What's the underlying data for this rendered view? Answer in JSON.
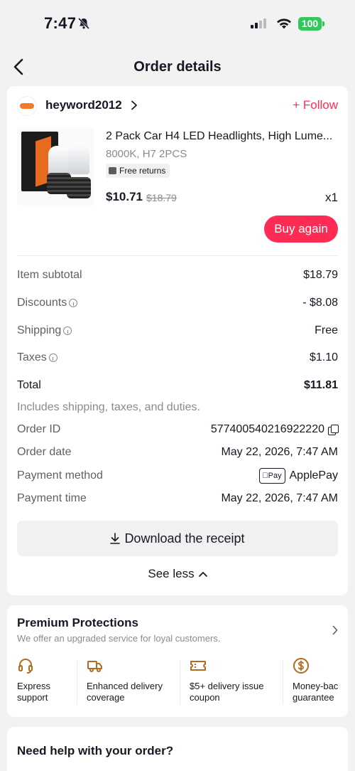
{
  "status_bar": {
    "time": "7:47",
    "battery": "100"
  },
  "nav": {
    "title": "Order details"
  },
  "seller": {
    "name": "heyword2012",
    "follow_label": "+ Follow"
  },
  "product": {
    "title": "2 Pack Car H4 LED Headlights, High Lume...",
    "variant": "8000K, H7 2PCS",
    "badge": "Free returns",
    "price": "$10.71",
    "original_price": "$18.79",
    "quantity": "x1",
    "buy_again_label": "Buy again"
  },
  "summary": {
    "item_subtotal": {
      "label": "Item subtotal",
      "value": "$18.79"
    },
    "discounts": {
      "label": "Discounts",
      "value": "- $8.08"
    },
    "shipping": {
      "label": "Shipping",
      "value": "Free"
    },
    "taxes": {
      "label": "Taxes",
      "value": "$1.10"
    },
    "total": {
      "label": "Total",
      "value": "$11.81"
    },
    "includes_note": "Includes shipping, taxes, and duties."
  },
  "order_info": {
    "order_id": {
      "label": "Order ID",
      "value": "577400540216922220"
    },
    "order_date": {
      "label": "Order date",
      "value": "May 22, 2026, 7:47 AM"
    },
    "payment_method": {
      "label": "Payment method",
      "badge": "Pay",
      "value": "ApplePay"
    },
    "payment_time": {
      "label": "Payment time",
      "value": "May 22, 2026, 7:47 AM"
    }
  },
  "actions": {
    "download_receipt": "Download the receipt",
    "see_less": "See less"
  },
  "premium": {
    "title": "Premium Protections",
    "subtitle": "We offer an upgraded service for loyal customers.",
    "features": [
      {
        "label": "Express\nsupport",
        "icon": "headset-icon"
      },
      {
        "label": "Enhanced delivery\ncoverage",
        "icon": "truck-icon"
      },
      {
        "label": "$5+ delivery issue\ncoupon",
        "icon": "coupon-icon"
      },
      {
        "label": "Money-bac\nguarantee",
        "icon": "dollar-circle-icon"
      }
    ]
  },
  "help": {
    "title": "Need help with your order?"
  },
  "colors": {
    "accent": "#fe2c55",
    "premium_icon": "#b06b1e"
  }
}
